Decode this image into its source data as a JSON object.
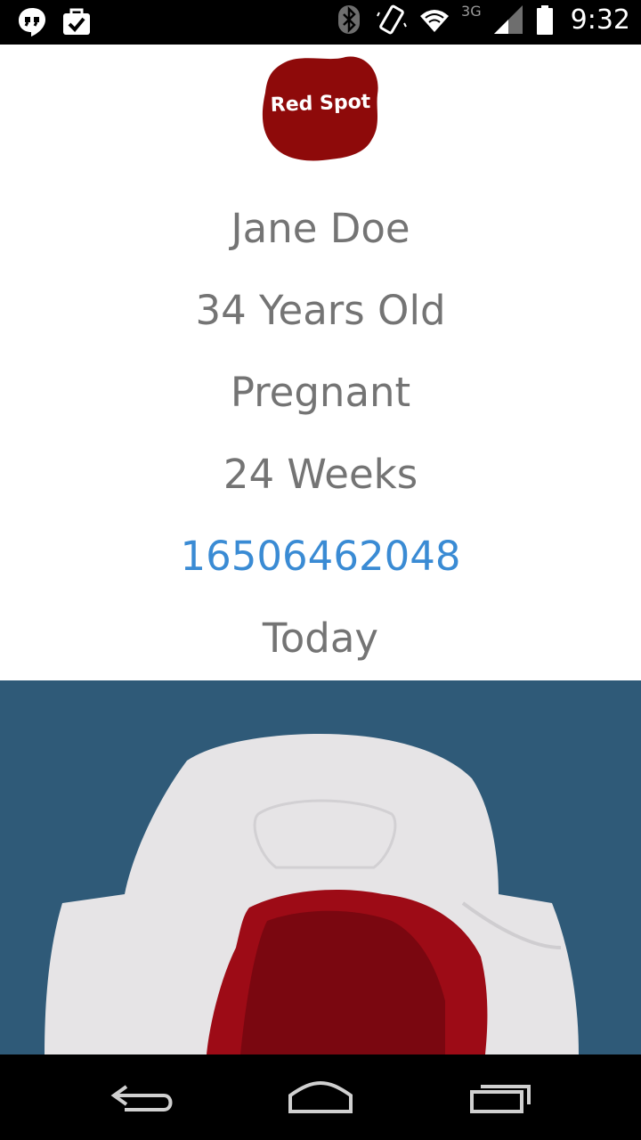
{
  "status_bar": {
    "left_icons": [
      "hangouts-icon",
      "briefcase-check-icon"
    ],
    "right_icons": [
      "bluetooth-icon",
      "vibrate-icon",
      "wifi-icon",
      "signal-icon",
      "battery-icon"
    ],
    "network": "3G",
    "time": "9:32"
  },
  "logo": {
    "text": "Red Spot",
    "color": "#8e0a0a"
  },
  "profile": {
    "name": "Jane Doe",
    "age": "34 Years Old",
    "status": "Pregnant",
    "weeks": "24 Weeks",
    "phone": "16506462048",
    "date": "Today"
  },
  "photo": {
    "icon": "sanitary-pad-photo"
  },
  "nav_bar": {
    "buttons": [
      "back-icon",
      "home-icon",
      "recent-apps-icon"
    ]
  },
  "colors": {
    "text": "#747474",
    "link": "#3a8bd4",
    "brand": "#8e0a0a",
    "photo_bg": "#2d5877"
  }
}
